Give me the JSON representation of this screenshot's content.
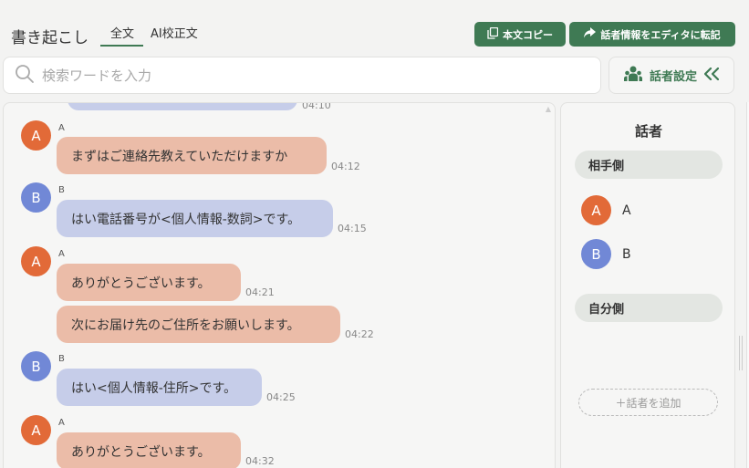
{
  "header": {
    "title": "書き起こし",
    "tabs": [
      {
        "label": "全文",
        "active": true
      },
      {
        "label": "AI校正文",
        "active": false
      }
    ],
    "copy_button": "本文コピー",
    "transfer_button": "話者情報をエディタに転記"
  },
  "search": {
    "placeholder": "検索ワードを入力",
    "value": ""
  },
  "speaker_settings_label": "話者設定",
  "chat": {
    "partial_timestamp": "04:10",
    "messages": [
      {
        "speaker": "A",
        "text": "まずはご連絡先教えていただけますか",
        "time": "04:12"
      },
      {
        "speaker": "B",
        "text": "はい電話番号が<個人情報-数詞>です。",
        "time": "04:15"
      },
      {
        "speaker": "A",
        "text": "ありがとうございます。",
        "time": "04:21"
      },
      {
        "speaker": "A",
        "text": "次にお届け先のご住所をお願いします。",
        "time": "04:22"
      },
      {
        "speaker": "B",
        "text": "はい<個人情報-住所>です。",
        "time": "04:25"
      },
      {
        "speaker": "A",
        "text": "ありがとうございます。",
        "time": "04:32"
      }
    ]
  },
  "speaker_panel": {
    "title": "話者",
    "groups": {
      "other": "相手側",
      "self": "自分側"
    },
    "speakers": [
      {
        "initial": "A",
        "name": "A"
      },
      {
        "initial": "B",
        "name": "B"
      }
    ],
    "add_button": "＋話者を追加"
  },
  "colors": {
    "accent": "#3f7a54",
    "speaker_a": "#e26a38",
    "speaker_b": "#7188d6",
    "bubble_a": "#ebbca8",
    "bubble_b": "#c6cde9"
  },
  "icons": [
    "copy-icon",
    "share-arrow-icon",
    "search-icon",
    "people-icon",
    "double-chevron-left-icon"
  ]
}
